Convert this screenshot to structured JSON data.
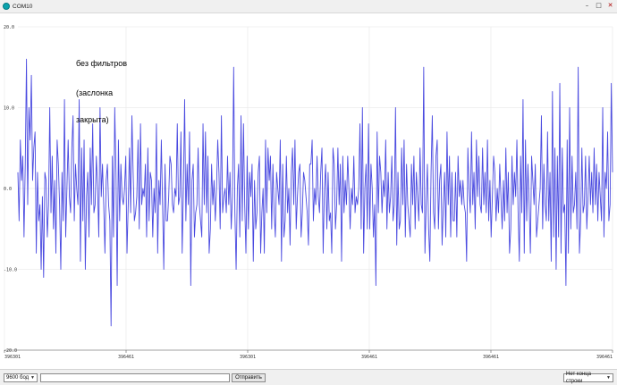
{
  "window": {
    "title": "COM10",
    "controls": {
      "minimize": "–",
      "maximize": "□",
      "close": "✕"
    }
  },
  "annotation": {
    "line1": "без фильтров",
    "line2": "(заслонка",
    "line3": "закрыта)"
  },
  "chart_data": {
    "type": "line",
    "title": "",
    "xlabel": "",
    "ylabel": "",
    "ylim": [
      -20.0,
      20.0
    ],
    "y_ticks": [
      "20.0",
      "10.0",
      "0.0",
      "-10.0",
      "-20.0"
    ],
    "x_ticks": [
      "396301",
      "396461",
      "396301",
      "396461",
      "396461",
      "396461"
    ],
    "grid": true,
    "line_color": "#4a4ae0",
    "series": [
      {
        "values": [
          2,
          -4,
          6,
          1,
          4,
          -6,
          3,
          16,
          -2,
          10,
          6,
          14,
          1,
          5,
          7,
          -8,
          2,
          -4,
          -2,
          -10,
          -1,
          -11,
          2,
          1,
          -6,
          -2,
          10,
          -3,
          4,
          -5,
          1,
          -8,
          6,
          3,
          -2,
          -10,
          2,
          -4,
          11,
          -6,
          0,
          6,
          -1,
          -3,
          5,
          9,
          -4,
          3,
          0,
          -2,
          11,
          -9,
          5,
          -4,
          6,
          -10,
          -1,
          2,
          -6,
          5,
          -2,
          8,
          -3,
          -2,
          4,
          0,
          -6,
          10,
          -1,
          3,
          -2,
          -8,
          1,
          3,
          -2,
          -4,
          -17,
          4,
          -6,
          10,
          2,
          -12,
          6,
          -4,
          3,
          -1,
          -2,
          0,
          4,
          -8,
          -2,
          5,
          -3,
          9,
          2,
          -4,
          -3,
          -1,
          6,
          -5,
          8,
          -2,
          0,
          -1,
          3,
          -6,
          5,
          -4,
          2,
          1,
          -6,
          0,
          -3,
          8,
          -8,
          1,
          -2,
          6,
          -2,
          -10,
          3,
          -4,
          -4,
          -1,
          4,
          3,
          -2,
          -3,
          0,
          -1,
          8,
          -2,
          -1,
          7,
          -8,
          0,
          11,
          -4,
          3,
          -2,
          7,
          -12,
          1,
          3,
          -6,
          -3,
          -2,
          5,
          -2,
          -4,
          -6,
          8,
          -2,
          7,
          -3,
          4,
          -8,
          -5,
          3,
          -2,
          1,
          -4,
          0,
          6,
          2,
          -5,
          9,
          -3,
          -1,
          0,
          -3,
          4,
          -2,
          2,
          -5,
          -1,
          15,
          -3,
          -10,
          0,
          3,
          -6,
          9,
          -4,
          8,
          -2,
          -8,
          4,
          -5,
          2,
          -1,
          3,
          -9,
          1,
          -5,
          -3,
          2,
          4,
          -8,
          -3,
          0,
          -8,
          6,
          -3,
          5,
          1,
          4,
          -5,
          3,
          -3,
          -6,
          2,
          0,
          -2,
          6,
          -9,
          3,
          -6,
          -4,
          4,
          -3,
          0,
          -7,
          2,
          5,
          -2,
          6,
          -5,
          -1,
          2,
          3,
          -6,
          -3,
          2,
          1,
          -1,
          -3,
          -7,
          3,
          3,
          6,
          -4,
          0,
          -2,
          4,
          -1,
          -3,
          2,
          5,
          -8,
          0,
          3,
          -5,
          2,
          -4,
          -3,
          -8,
          5,
          3,
          -5,
          -2,
          5,
          -2,
          3,
          -9,
          4,
          -3,
          1,
          -2,
          4,
          0,
          -5,
          0,
          -2,
          4,
          -3,
          -1,
          -2,
          0,
          8,
          -5,
          10,
          -8,
          0,
          3,
          -5,
          8,
          -5,
          3,
          0,
          -6,
          -2,
          -12,
          7,
          -3,
          4,
          2,
          -3,
          1,
          -1,
          6,
          -5,
          2,
          -3,
          -1,
          4,
          -4,
          -2,
          10,
          -7,
          2,
          -5,
          -4,
          5,
          -2,
          6,
          -6,
          3,
          -2,
          -4,
          -6,
          3,
          -2,
          4,
          -5,
          2,
          -1,
          -4,
          5,
          -2,
          -3,
          15,
          -8,
          -2,
          3,
          -5,
          -9,
          2,
          9,
          -3,
          -5,
          4,
          6,
          -5,
          1,
          3,
          -7,
          -2,
          2,
          -6,
          7,
          -2,
          4,
          -6,
          2,
          -4,
          -4,
          2,
          -6,
          4,
          -1,
          1,
          -2,
          1,
          -2,
          -3,
          -9,
          5,
          0,
          -3,
          7,
          -2,
          2,
          -5,
          6,
          -1,
          4,
          -2,
          -3,
          5,
          -2,
          2,
          -3,
          6,
          -4,
          1,
          -6,
          -1,
          4,
          2,
          -4,
          0,
          -3,
          3,
          -1,
          -5,
          1,
          -4,
          5,
          -3,
          2,
          -8,
          -5,
          4,
          -2,
          2,
          -1,
          6,
          -3,
          -9,
          4,
          -3,
          11,
          -8,
          6,
          -4,
          3,
          -2,
          -8,
          4,
          1,
          -2,
          3,
          -6,
          -4,
          -2,
          0,
          9,
          -5,
          3,
          -2,
          -4,
          7,
          -4,
          2,
          -9,
          12,
          -6,
          5,
          -10,
          4,
          -6,
          13,
          -8,
          5,
          -3,
          -2,
          -12,
          6,
          -8,
          10,
          -5,
          4,
          -3,
          -2,
          2,
          -5,
          15,
          -8,
          -4,
          5,
          -3,
          -2,
          4,
          -5,
          -1,
          4,
          -2,
          2,
          -3,
          5,
          -2,
          3,
          -4,
          2,
          -1,
          -4,
          10,
          -6,
          2,
          0,
          7,
          -4,
          -2,
          13,
          2
        ]
      }
    ]
  },
  "statusbar": {
    "baud_rate": "9600 бод",
    "send_label": "Отправить",
    "line_ending": "Нет конца строки",
    "autoscroll_label": ""
  }
}
